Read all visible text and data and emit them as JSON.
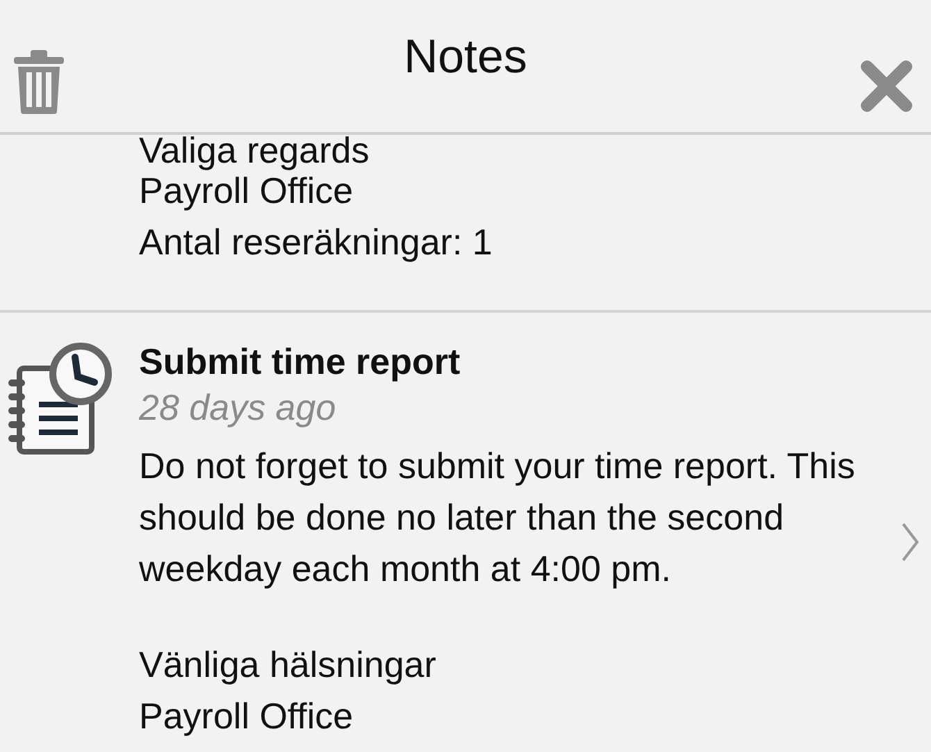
{
  "header": {
    "title": "Notes"
  },
  "notes": [
    {
      "kind": "continued",
      "lines": [
        "Valiga regards",
        "Payroll Office",
        "Antal reseräkningar: 1"
      ]
    },
    {
      "kind": "message",
      "title": "Submit time report",
      "time": "28 days ago",
      "paragraphs": [
        [
          "Do not forget to submit your time report. This should be done no later than the second weekday each month at 4:00 pm."
        ],
        [
          "Vänliga hälsningar",
          "Payroll Office"
        ]
      ]
    }
  ]
}
